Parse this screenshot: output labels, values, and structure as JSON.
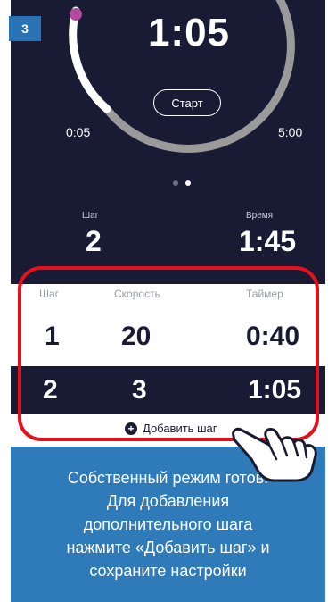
{
  "step_badge": "3",
  "timer": {
    "display": "1:05",
    "start_label": "Старт",
    "range_min": "0:05",
    "range_max": "5:00",
    "progress_fraction": 0.2,
    "colors": {
      "track": "#9a9a9a",
      "elapsed": "#ffffff",
      "marker": "#b24a9e"
    }
  },
  "pager": {
    "pages": 2,
    "active": 2
  },
  "summary": {
    "step_label": "Шаг",
    "step_value": "2",
    "time_label": "Время",
    "time_value": "1:45"
  },
  "table": {
    "headers": [
      "Шаг",
      "Скорость",
      "Таймер"
    ],
    "rows": [
      {
        "step": "1",
        "speed": "20",
        "timer": "0:40"
      },
      {
        "step": "2",
        "speed": "3",
        "timer": "1:05"
      }
    ]
  },
  "add_step_label": "Добавить шаг",
  "caption_lines": [
    "Собственный режим готов!",
    "Для добавления",
    "дополнительного шага",
    "нажмите «Добавить шаг» и",
    "сохраните настройки"
  ],
  "colors": {
    "dark_bg": "#181b33",
    "caption_bg": "#2f7ab9",
    "badge_bg": "#2a73b6",
    "highlight": "#e3101e"
  }
}
